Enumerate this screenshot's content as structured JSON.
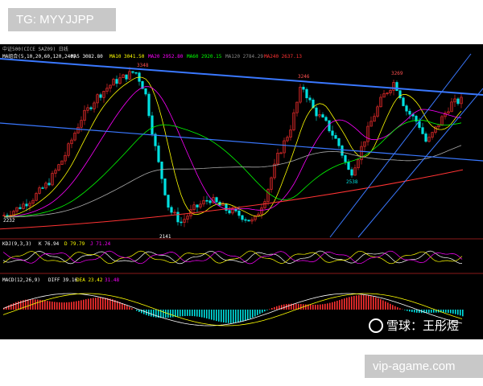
{
  "overlay": {
    "tg_label": "TG: MYYJJPP",
    "site_label": "vip-agame.com",
    "watermark_text": "雪球：王彤煜"
  },
  "chart_data": [
    {
      "type": "candlestick",
      "header": {
        "title": "中证500(CICE SAZ09) 日线",
        "ma_label": "MA组合(5,10,20,60,120,240)",
        "ma_values": [
          {
            "name": "MA5",
            "value": "3082.80",
            "color": "#ffffff"
          },
          {
            "name": "MA10",
            "value": "3041.50",
            "color": "#ffff00"
          },
          {
            "name": "MA20",
            "value": "2952.80",
            "color": "#ff00ff"
          },
          {
            "name": "MA60",
            "value": "2920.15",
            "color": "#00ff00"
          },
          {
            "name": "MA120",
            "value": "2784.29",
            "color": "#888888"
          },
          {
            "name": "MA240",
            "value": "2637.13",
            "color": "#ff3333"
          }
        ]
      },
      "annotations": [
        "3348",
        "3246",
        "3269",
        "2538",
        "2141",
        "2232"
      ],
      "colors": {
        "up": "#ff3030",
        "down": "#00e0e0",
        "trendline": "#3a78ff"
      }
    },
    {
      "type": "line",
      "header": {
        "label": "KDJ(9,3,3)",
        "k": "K 76.94",
        "d": "D 79.79",
        "j": "J 71.24"
      }
    },
    {
      "type": "bar",
      "header": {
        "label": "MACD(12,26,9)",
        "diff": "DIFF 39.16",
        "dea": "DEA 23.42",
        "macd": "31.48"
      }
    }
  ]
}
